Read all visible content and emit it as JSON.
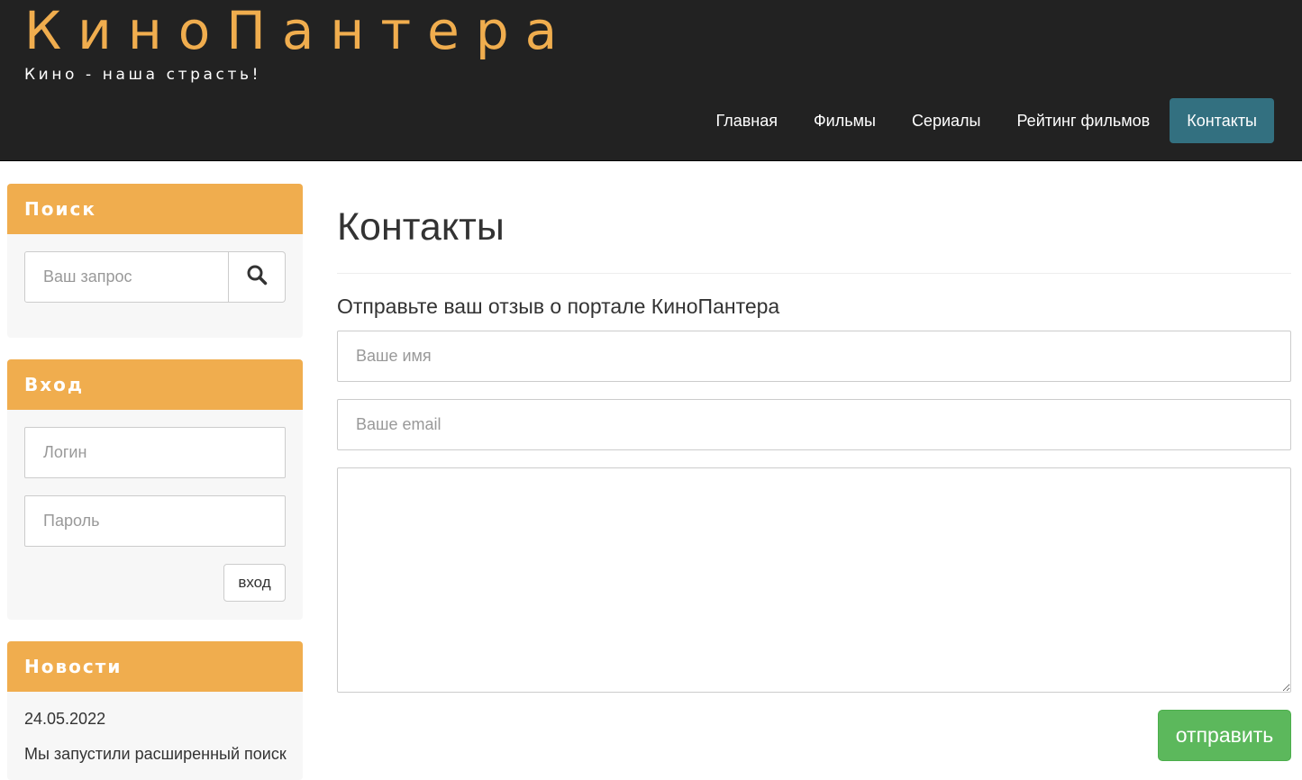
{
  "brand": {
    "title": "КиноПантера",
    "tagline": "Кино - наша страсть!",
    "accent_color": "#f0ad4e",
    "header_bg": "#222222"
  },
  "nav": {
    "items": [
      {
        "label": "Главная"
      },
      {
        "label": "Фильмы"
      },
      {
        "label": "Сериалы"
      },
      {
        "label": "Рейтинг фильмов"
      },
      {
        "label": "Контакты",
        "active": true
      }
    ],
    "active_color": "#337080"
  },
  "sidebar": {
    "search": {
      "title": "Поиск",
      "placeholder": "Ваш запрос",
      "button_icon": "search-icon"
    },
    "login": {
      "title": "Вход",
      "login_placeholder": "Логин",
      "password_placeholder": "Пароль",
      "button_label": "вход"
    },
    "news": {
      "title": "Новости",
      "items": [
        {
          "date": "24.05.2022",
          "text": "Мы запустили расширенный поиск"
        }
      ]
    }
  },
  "main": {
    "title": "Контакты",
    "form": {
      "lead": "Отправьте ваш отзыв о портале КиноПантера",
      "name_placeholder": "Ваше имя",
      "email_placeholder": "Ваше email",
      "message_placeholder": "",
      "submit_label": "отправить",
      "submit_color": "#5cb85c"
    }
  }
}
